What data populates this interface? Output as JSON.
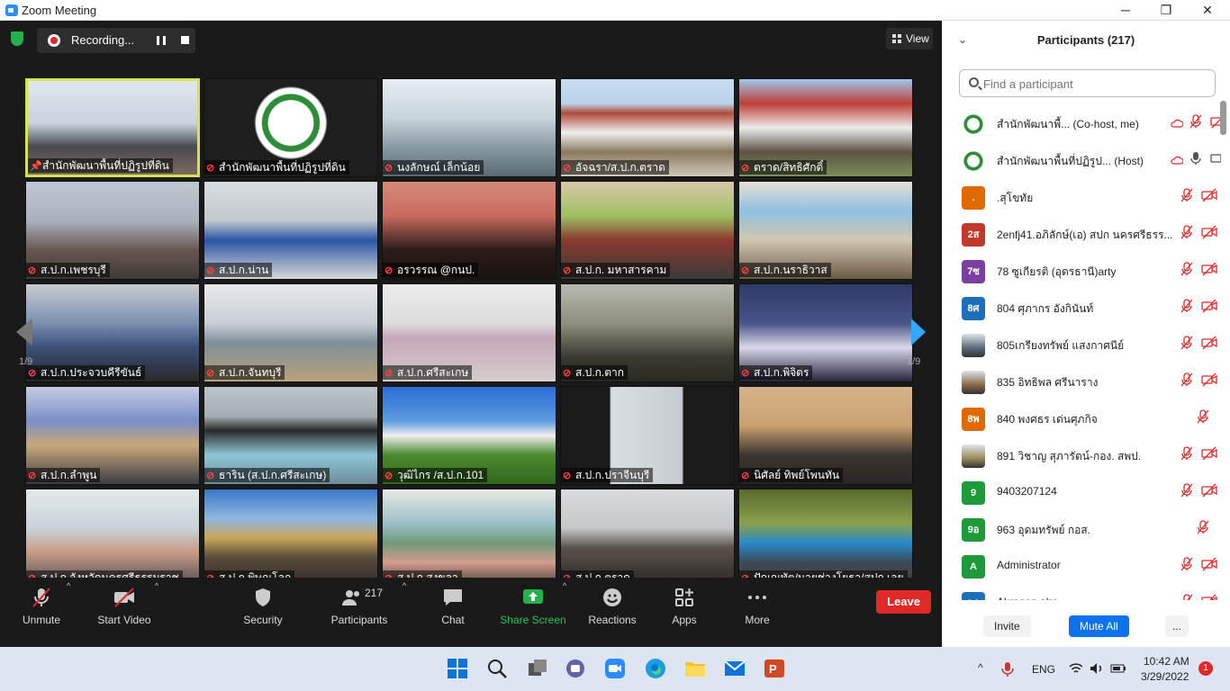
{
  "window": {
    "title": "Zoom Meeting",
    "min": "─",
    "max": "❐",
    "close": "✕"
  },
  "recording": {
    "label": "Recording..."
  },
  "view": {
    "label": "View"
  },
  "gallery": {
    "page": "1/9",
    "tiles": [
      {
        "name": "สำนักพัฒนาพื้นที่ปฏิรูปที่ดิน",
        "bg": "linear-gradient(180deg,#dfe6ee 0%,#c9d3de 45%,#4a4a52 70%,#7a6a5f 100%)",
        "active": true,
        "mic": "pin"
      },
      {
        "name": "สำนักพัฒนาพื้นที่ปฏิรูปที่ดิน",
        "bg": "radial-gradient(circle at 50% 45%,#fff 0 22%,#2e8b3a 23% 28%,#fff 29% 34%,#1e1e1e 36%)",
        "mic": "muted"
      },
      {
        "name": "นงลักษณ์ เล็กน้อย",
        "bg": "linear-gradient(180deg,#e8eef2 0%,#c6d4dc 40%,#8a9aa4 70%,#5a6a74 100%)",
        "mic": "muted"
      },
      {
        "name": "อัจฉรา/ส.ป.ก.ตราด",
        "bg": "linear-gradient(180deg,#c6dcf0 0%,#b9d2ea 25%,#b04b3a 35%,#eee 55%,#8a7a5e 75%,#cfc8b8 100%)",
        "mic": "muted"
      },
      {
        "name": "ตราด/สิทธิศักดิ์",
        "bg": "linear-gradient(180deg,#9fc8e8 0%,#bf3f3a 25%,#ececec 50%,#5d5344 75%,#7c8f5a 100%)",
        "mic": "muted"
      },
      {
        "name": "ส.ป.ก.เพชรบุรี",
        "bg": "linear-gradient(180deg,#c0c8d2 0%,#a8b2bf 40%,#6a5850 70%,#3e3a3a 100%)",
        "mic": "muted"
      },
      {
        "name": "ส.ป.ก.น่าน",
        "bg": "linear-gradient(180deg,#d8dde2 0%,#c3c8cd 40%,#2a56a6 60%,#d8d8d8 100%)",
        "mic": "muted"
      },
      {
        "name": "อรวรรณ @กนป.",
        "bg": "linear-gradient(180deg,#d48a7a 0%,#c96a5e 35%,#2c1d1a 70%,#1a1212 100%)",
        "mic": "muted"
      },
      {
        "name": "ส.ป.ก. มหาสารคาม",
        "bg": "linear-gradient(180deg,#d8c7a8 0%,#9fc060 35%,#8b3a2e 60%,#3a3a3a 100%)",
        "mic": "muted"
      },
      {
        "name": "ส.ป.ก.นราธิวาส",
        "bg": "linear-gradient(180deg,#e6e0d4 0%,#8fc0e0 30%,#d2c6b0 60%,#6a5a44 100%)",
        "mic": "muted"
      },
      {
        "name": "ส.ป.ก.ประจวบคีรีขันธ์",
        "bg": "linear-gradient(180deg,#c8ccd0 0%,#7a90b0 40%,#3b4f78 65%,#2a2a2a 100%)",
        "mic": "muted"
      },
      {
        "name": "ส.ป.ก.จันทบุรี",
        "bg": "linear-gradient(180deg,#e8eaec 0%,#c8ced4 40%,#7f8f9a 60%,#b8a27a 100%)",
        "mic": "muted"
      },
      {
        "name": "ส.ป.ก.ศรีสะเกษ",
        "bg": "linear-gradient(180deg,#ececec 0%,#dcdcdc 40%,#c6a6b8 55%,#d4cfcc 100%)",
        "mic": "muted"
      },
      {
        "name": "ส.ป.ก.ตาก",
        "bg": "linear-gradient(180deg,#b7b9ae 0%,#8e8f7e 40%,#3a3a30 75%,#2a2a24 100%)",
        "mic": "muted"
      },
      {
        "name": "ส.ป.ก.พิจิตร",
        "bg": "linear-gradient(180deg,#2e3a68 0%,#4a5488 40%,#d8d6e8 65%,#27243e 100%)",
        "mic": "muted"
      },
      {
        "name": "ส.ป.ก.ลำพูน",
        "bg": "linear-gradient(180deg,#c6cce0 0%,#7a8ec8 35%,#c9a879 60%,#3c3c46 100%)",
        "mic": "muted"
      },
      {
        "name": "ธาริน (ส.ป.ก.ศรีสะเกษ)",
        "bg": "linear-gradient(180deg,#bcc4ca 0%,#a5aeb4 30%,#2a2a2a 45%,#8fc7d8 70%,#6d8a98 100%)",
        "mic": "muted"
      },
      {
        "name": "วุฒิไกร /ส.ป.ก.101",
        "bg": "linear-gradient(180deg,#2c6dd4 0%,#5c9ae0 35%,#eee 50%,#4a8a2e 70%,#2f6a1c 100%)",
        "mic": "muted"
      },
      {
        "name": "ส.ป.ก.ปราจีนบุรี",
        "bg": "linear-gradient(90deg,#1b1b1b 0%,#1b1b1b 28%,#d8dde2 29%,#c8ccd0 70%,#1b1b1b 71%)",
        "mic": "muted"
      },
      {
        "name": "นิศัลย์ ทิพย์โพนทัน",
        "bg": "linear-gradient(180deg,#d6b58a 0%,#caa070 40%,#3b3632 70%,#2a2624 100%)",
        "mic": "muted"
      },
      {
        "name": "ส.ป.ก.จังหวัดนครศรีธรรมราช",
        "bg": "linear-gradient(180deg,#e4e8ea 0%,#c8d2d8 40%,#c89a86 65%,#4a4a52 100%)",
        "mic": "muted"
      },
      {
        "name": "ส.ป.ก.พิษณุโลก",
        "bg": "linear-gradient(180deg,#3a76c8 0%,#8fb8e0 30%,#c9a45a 50%,#5a4c3e 70%,#2f2a26 100%)",
        "mic": "muted"
      },
      {
        "name": "ส.ป.ก.สงขลา",
        "bg": "linear-gradient(180deg,#eae8e2 0%,#9ac0c8 35%,#6f9a78 55%,#d49c8c 75%,#443e3a 100%)",
        "mic": "muted"
      },
      {
        "name": "ส.ป.ก.ตราด",
        "bg": "linear-gradient(180deg,#d9dadc 0%,#c4c6c8 40%,#5a524c 60%,#2a2624 100%)",
        "mic": "muted"
      },
      {
        "name": "ปัณณทัต/นายช่างโยธา/สปก.เลย",
        "bg": "linear-gradient(180deg,#5a6a2e 0%,#8aa04c 35%,#2a8ac8 55%,#3a4a5a 75%,#4a3e2e 100%)",
        "mic": "muted"
      }
    ]
  },
  "toolbar": {
    "unmute": "Unmute",
    "start_video": "Start Video",
    "security": "Security",
    "participants": "Participants",
    "participants_count": "217",
    "chat": "Chat",
    "share_screen": "Share Screen",
    "reactions": "Reactions",
    "apps": "Apps",
    "more": "More",
    "leave": "Leave"
  },
  "panel": {
    "title": "Participants (217)",
    "search_placeholder": "Find a participant",
    "participants": [
      {
        "avatar": "",
        "name": "สำนักพัฒนาพื้...  (Co-host, me)",
        "color": "#2e8b3a",
        "logo": true,
        "status": "☁ 🎙 ▭",
        "mic": "muted",
        "video": "off"
      },
      {
        "avatar": "",
        "name": "สำนักพัฒนาพื้นที่ปฏิรูป...  (Host)",
        "color": "#2e8b3a",
        "logo": true,
        "mic": "on",
        "video": "on"
      },
      {
        "avatar": ".",
        "name": ".สุโขทัย",
        "color": "#e06a00",
        "mic": "muted",
        "video": "off"
      },
      {
        "avatar": "2ส",
        "name": "2enfj41.อภิลักษ์(เอ) สปก นครศรีธรร...",
        "color": "#c0392b",
        "mic": "muted",
        "video": "off"
      },
      {
        "avatar": "7ซ",
        "name": "78 ซูเกียรติ (อุดรธานี)arty",
        "color": "#7b3fa0",
        "mic": "muted",
        "video": "off"
      },
      {
        "avatar": "8ศ",
        "name": "804 ศุภากร อังกินันท์",
        "color": "#1e6fb8",
        "mic": "muted",
        "video": "off"
      },
      {
        "avatar": "",
        "name": "805เกรียงทรัพย์ แสงกาศนีย์",
        "color": "#5a6a7a",
        "photo": true,
        "mic": "muted",
        "video": "off"
      },
      {
        "avatar": "",
        "name": "835 อิทธิพล ศรีนาราง",
        "color": "#8a6a4a",
        "photo": true,
        "mic": "muted",
        "video": "off"
      },
      {
        "avatar": "8พ",
        "name": "840 พงศธร เด่นศุภกิจ",
        "color": "#e06a00",
        "mic": "muted",
        "video": "none"
      },
      {
        "avatar": "",
        "name": "891 วิชาญ  สุภารัตน์-กอง. สพป.",
        "color": "#9a8a5a",
        "photo": true,
        "mic": "muted",
        "video": "off"
      },
      {
        "avatar": "9",
        "name": "9403207124",
        "color": "#1f9a3a",
        "mic": "muted",
        "video": "off"
      },
      {
        "avatar": "9อ",
        "name": "963 อุดมทรัพย์ กอส.",
        "color": "#1f9a3a",
        "mic": "muted",
        "video": "none"
      },
      {
        "avatar": "A",
        "name": "Administrator",
        "color": "#1f9a3a",
        "mic": "muted",
        "video": "off"
      },
      {
        "avatar": "AA",
        "name": "Akrapon alro",
        "color": "#1e6fb8",
        "mic": "muted",
        "video": "off"
      }
    ],
    "invite": "Invite",
    "mute_all": "Mute All",
    "more": "..."
  },
  "taskbar": {
    "lang": "ENG",
    "time": "10:42 AM",
    "date": "3/29/2022",
    "notif": "1"
  }
}
